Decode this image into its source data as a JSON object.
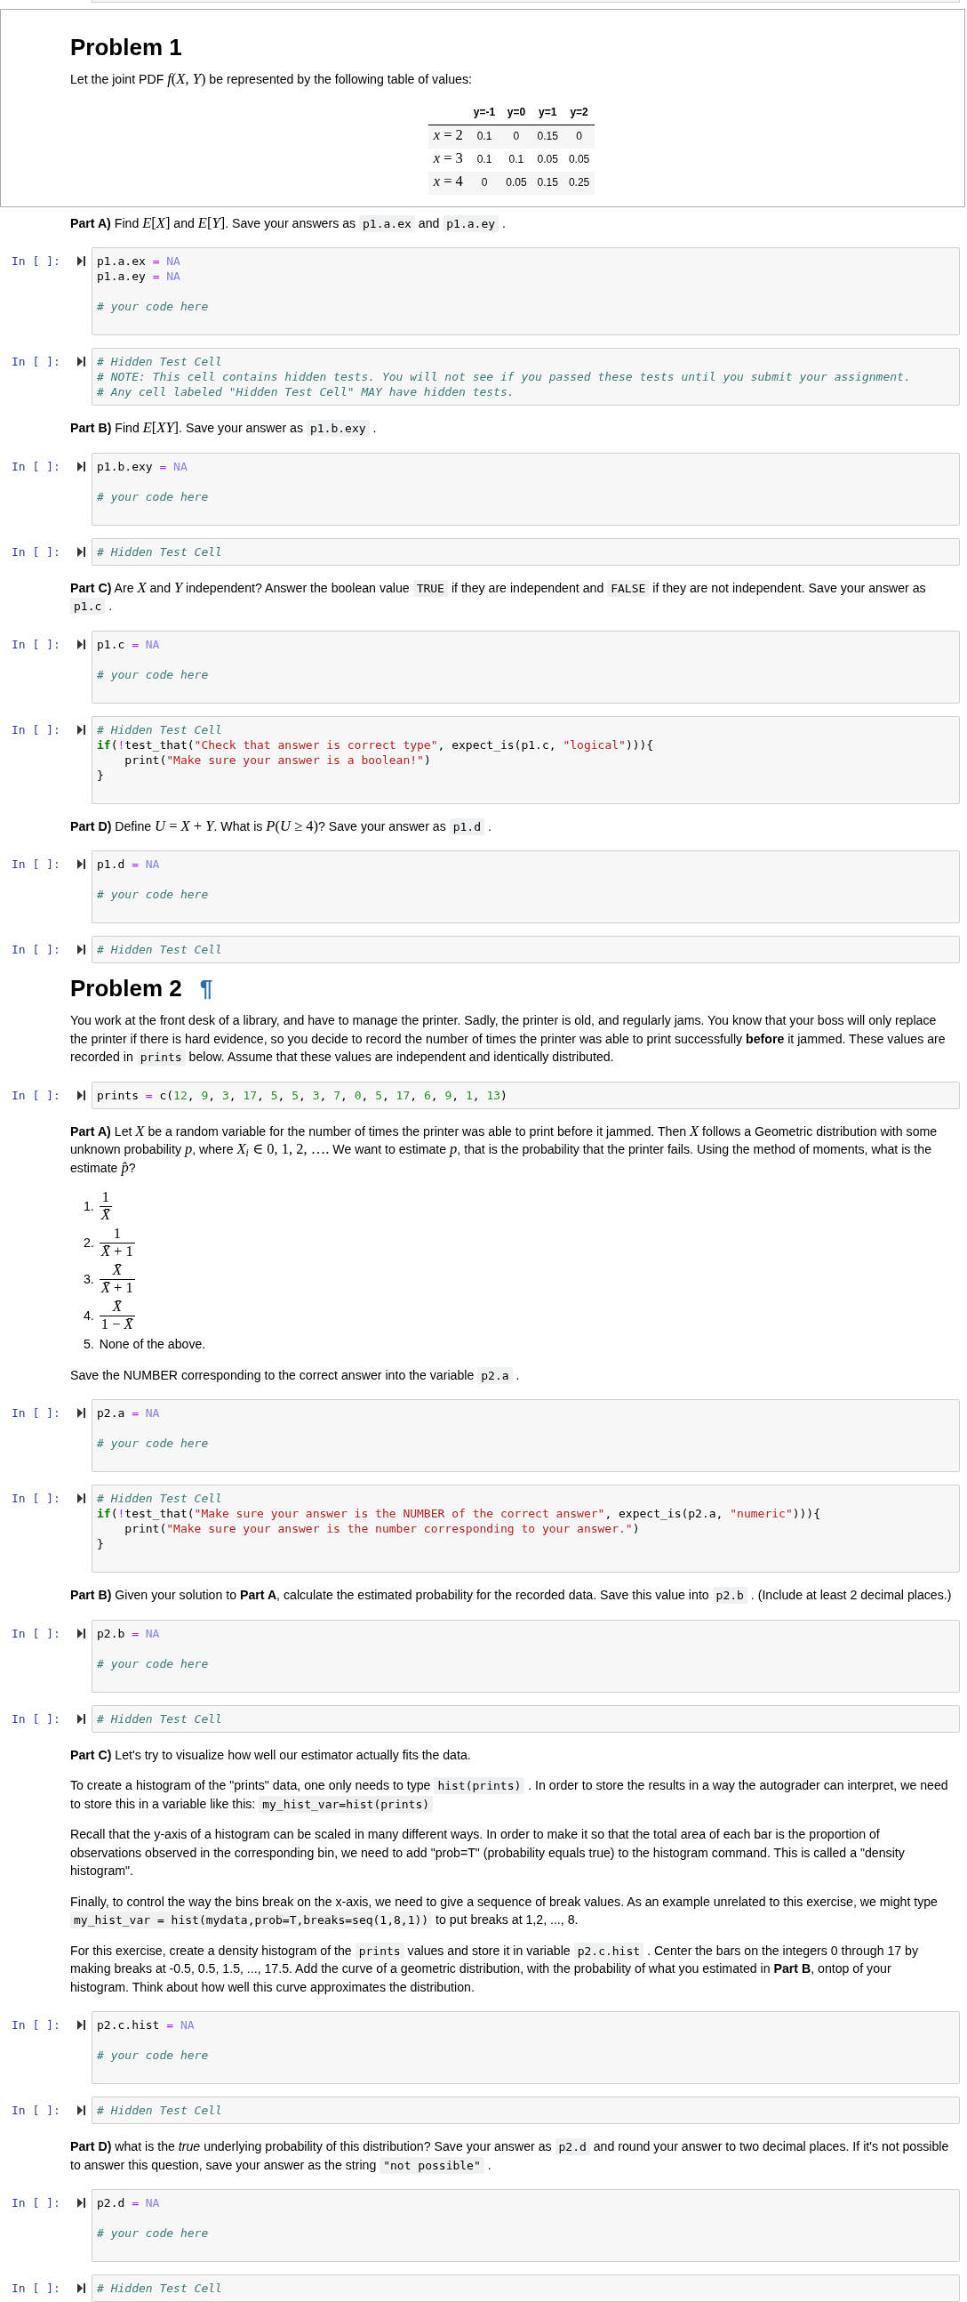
{
  "cells": [
    {
      "kind": "markdown",
      "selected": true,
      "blocks": [
        {
          "kind": "heading",
          "text": "Problem 1"
        },
        {
          "kind": "paragraph",
          "runs": [
            {
              "kind": "text",
              "text": "Let the joint PDF "
            },
            {
              "kind": "math",
              "text": "*f*(*X*, *Y*)"
            },
            {
              "kind": "text",
              "text": " be represented by the following table of values:"
            }
          ]
        },
        {
          "kind": "table",
          "columns": [
            "y=-1",
            "y=0",
            "y=1",
            "y=2"
          ],
          "rows": [
            {
              "label": "*x* = 2",
              "cells": [
                "0.1",
                "0",
                "0.15",
                "0"
              ]
            },
            {
              "label": "*x* = 3",
              "cells": [
                "0.1",
                "0.1",
                "0.05",
                "0.05"
              ]
            },
            {
              "label": "*x* = 4",
              "cells": [
                "0",
                "0.05",
                "0.15",
                "0.25"
              ]
            }
          ]
        }
      ]
    },
    {
      "kind": "markdown",
      "selected": false,
      "blocks": [
        {
          "kind": "paragraph",
          "runs": [
            {
              "kind": "text",
              "text": "**Part A)** Find "
            },
            {
              "kind": "math",
              "text": "*E*[*X*]"
            },
            {
              "kind": "text",
              "text": " and "
            },
            {
              "kind": "math",
              "text": "*E*[*Y*]"
            },
            {
              "kind": "text",
              "text": ". Save your answers as "
            },
            {
              "kind": "code",
              "text": "p1.a.ex"
            },
            {
              "kind": "text",
              "text": " and "
            },
            {
              "kind": "code",
              "text": "p1.a.ey"
            },
            {
              "kind": "text",
              "text": " ."
            }
          ]
        }
      ]
    },
    {
      "kind": "code",
      "selected": false,
      "prompt": "In [ ]:",
      "lines": [
        {
          "kind": "code",
          "tokens": [
            {
              "kind": "plain",
              "text": "p1.a.ex "
            },
            {
              "kind": "operator",
              "text": "="
            },
            {
              "kind": "constant",
              "text": " NA"
            }
          ]
        },
        {
          "kind": "code",
          "tokens": [
            {
              "kind": "plain",
              "text": "p1.a.ey "
            },
            {
              "kind": "operator",
              "text": "="
            },
            {
              "kind": "constant",
              "text": " NA"
            }
          ]
        },
        {
          "kind": "blank"
        },
        {
          "kind": "code",
          "tokens": [
            {
              "kind": "comment",
              "text": "# your code here"
            }
          ]
        },
        {
          "kind": "blank"
        }
      ]
    },
    {
      "kind": "code",
      "selected": false,
      "prompt": "In [ ]:",
      "lines": [
        {
          "kind": "code",
          "tokens": [
            {
              "kind": "comment",
              "text": "# Hidden Test Cell"
            }
          ]
        },
        {
          "kind": "code",
          "tokens": [
            {
              "kind": "comment",
              "text": "# NOTE: This cell contains hidden tests. You will not see if you passed these tests until you submit your assignment."
            }
          ]
        },
        {
          "kind": "code",
          "tokens": [
            {
              "kind": "comment",
              "text": "# Any cell labeled \"Hidden Test Cell\" MAY have hidden tests."
            }
          ]
        }
      ]
    },
    {
      "kind": "markdown",
      "selected": false,
      "blocks": [
        {
          "kind": "paragraph",
          "runs": [
            {
              "kind": "text",
              "text": "**Part B)** Find "
            },
            {
              "kind": "math",
              "text": "*E*[*XY*]"
            },
            {
              "kind": "text",
              "text": ". Save your answer as "
            },
            {
              "kind": "code",
              "text": "p1.b.exy"
            },
            {
              "kind": "text",
              "text": " ."
            }
          ]
        }
      ]
    },
    {
      "kind": "code",
      "selected": false,
      "prompt": "In [ ]:",
      "lines": [
        {
          "kind": "code",
          "tokens": [
            {
              "kind": "plain",
              "text": "p1.b.exy "
            },
            {
              "kind": "operator",
              "text": "="
            },
            {
              "kind": "constant",
              "text": " NA"
            }
          ]
        },
        {
          "kind": "blank"
        },
        {
          "kind": "code",
          "tokens": [
            {
              "kind": "comment",
              "text": "# your code here"
            }
          ]
        },
        {
          "kind": "blank"
        }
      ]
    },
    {
      "kind": "code",
      "selected": false,
      "prompt": "In [ ]:",
      "lines": [
        {
          "kind": "code",
          "tokens": [
            {
              "kind": "comment",
              "text": "# Hidden Test Cell"
            }
          ]
        }
      ]
    },
    {
      "kind": "markdown",
      "selected": false,
      "blocks": [
        {
          "kind": "paragraph",
          "runs": [
            {
              "kind": "text",
              "text": "**Part C)** Are "
            },
            {
              "kind": "variable",
              "text": "X"
            },
            {
              "kind": "text",
              "text": " and "
            },
            {
              "kind": "variable",
              "text": "Y"
            },
            {
              "kind": "text",
              "text": " independent? Answer the boolean value "
            },
            {
              "kind": "code",
              "text": "TRUE"
            },
            {
              "kind": "text",
              "text": " if they are independent and "
            },
            {
              "kind": "code",
              "text": "FALSE"
            },
            {
              "kind": "text",
              "text": " if they are not independent. Save your answer as "
            },
            {
              "kind": "code",
              "text": "p1.c"
            },
            {
              "kind": "text",
              "text": " ."
            }
          ]
        }
      ]
    },
    {
      "kind": "code",
      "selected": false,
      "prompt": "In [ ]:",
      "lines": [
        {
          "kind": "code",
          "tokens": [
            {
              "kind": "plain",
              "text": "p1.c "
            },
            {
              "kind": "operator",
              "text": "="
            },
            {
              "kind": "constant",
              "text": " NA"
            }
          ]
        },
        {
          "kind": "blank"
        },
        {
          "kind": "code",
          "tokens": [
            {
              "kind": "comment",
              "text": "# your code here"
            }
          ]
        },
        {
          "kind": "blank"
        }
      ]
    },
    {
      "kind": "code",
      "selected": false,
      "prompt": "In [ ]:",
      "lines": [
        {
          "kind": "code",
          "tokens": [
            {
              "kind": "comment",
              "text": "# Hidden Test Cell"
            }
          ]
        },
        {
          "kind": "code",
          "tokens": [
            {
              "kind": "keyword",
              "text": "if"
            },
            {
              "kind": "plain",
              "text": "("
            },
            {
              "kind": "operator",
              "text": "!"
            },
            {
              "kind": "plain",
              "text": "test_that("
            },
            {
              "kind": "string",
              "text": "\"Check that answer is correct type\""
            },
            {
              "kind": "plain",
              "text": ", expect_is(p1.c, "
            },
            {
              "kind": "string",
              "text": "\"logical\""
            },
            {
              "kind": "plain",
              "text": "))){"
            }
          ]
        },
        {
          "kind": "code",
          "tokens": [
            {
              "kind": "plain",
              "text": "    print("
            },
            {
              "kind": "string",
              "text": "\"Make sure your answer is a boolean!\""
            },
            {
              "kind": "plain",
              "text": ")"
            }
          ]
        },
        {
          "kind": "code",
          "tokens": [
            {
              "kind": "plain",
              "text": "}"
            }
          ]
        },
        {
          "kind": "blank"
        }
      ]
    },
    {
      "kind": "markdown",
      "selected": false,
      "blocks": [
        {
          "kind": "paragraph",
          "runs": [
            {
              "kind": "text",
              "text": "**Part D)** Define "
            },
            {
              "kind": "math",
              "text": "*U* = *X* + *Y*"
            },
            {
              "kind": "text",
              "text": ". What is "
            },
            {
              "kind": "math",
              "text": "*P*(*U* ≥ 4)"
            },
            {
              "kind": "text",
              "text": "? Save your answer as "
            },
            {
              "kind": "code",
              "text": "p1.d"
            },
            {
              "kind": "text",
              "text": " ."
            }
          ]
        }
      ]
    },
    {
      "kind": "code",
      "selected": false,
      "prompt": "In [ ]:",
      "lines": [
        {
          "kind": "code",
          "tokens": [
            {
              "kind": "plain",
              "text": "p1.d "
            },
            {
              "kind": "operator",
              "text": "="
            },
            {
              "kind": "constant",
              "text": " NA"
            }
          ]
        },
        {
          "kind": "blank"
        },
        {
          "kind": "code",
          "tokens": [
            {
              "kind": "comment",
              "text": "# your code here"
            }
          ]
        },
        {
          "kind": "blank"
        }
      ]
    },
    {
      "kind": "code",
      "selected": false,
      "prompt": "In [ ]:",
      "lines": [
        {
          "kind": "code",
          "tokens": [
            {
              "kind": "comment",
              "text": "# Hidden Test Cell"
            }
          ]
        }
      ]
    },
    {
      "kind": "markdown",
      "selected": false,
      "blocks": [
        {
          "kind": "heading",
          "text": "Problem 2",
          "anchor": "¶"
        },
        {
          "kind": "paragraph",
          "runs": [
            {
              "kind": "text",
              "text": "You work at the front desk of a library, and have to manage the printer. Sadly, the printer is old, and regularly jams. You know that your boss will only replace the printer if there is hard evidence, so you decide to record the number of times the printer was able to print successfully **before** it jammed. These values are recorded in "
            },
            {
              "kind": "code",
              "text": "prints"
            },
            {
              "kind": "text",
              "text": " below. Assume that these values are independent and identically distributed."
            }
          ]
        }
      ]
    },
    {
      "kind": "code",
      "selected": false,
      "prompt": "In [ ]:",
      "lines": [
        {
          "kind": "code",
          "tokens": [
            {
              "kind": "plain",
              "text": "prints "
            },
            {
              "kind": "operator",
              "text": "="
            },
            {
              "kind": "plain",
              "text": " c("
            },
            {
              "kind": "number",
              "text": "12"
            },
            {
              "kind": "plain",
              "text": ", "
            },
            {
              "kind": "number",
              "text": "9"
            },
            {
              "kind": "plain",
              "text": ", "
            },
            {
              "kind": "number",
              "text": "3"
            },
            {
              "kind": "plain",
              "text": ", "
            },
            {
              "kind": "number",
              "text": "17"
            },
            {
              "kind": "plain",
              "text": ", "
            },
            {
              "kind": "number",
              "text": "5"
            },
            {
              "kind": "plain",
              "text": ", "
            },
            {
              "kind": "number",
              "text": "5"
            },
            {
              "kind": "plain",
              "text": ", "
            },
            {
              "kind": "number",
              "text": "3"
            },
            {
              "kind": "plain",
              "text": ", "
            },
            {
              "kind": "number",
              "text": "7"
            },
            {
              "kind": "plain",
              "text": ", "
            },
            {
              "kind": "number",
              "text": "0"
            },
            {
              "kind": "plain",
              "text": ", "
            },
            {
              "kind": "number",
              "text": "5"
            },
            {
              "kind": "plain",
              "text": ", "
            },
            {
              "kind": "number",
              "text": "17"
            },
            {
              "kind": "plain",
              "text": ", "
            },
            {
              "kind": "number",
              "text": "6"
            },
            {
              "kind": "plain",
              "text": ", "
            },
            {
              "kind": "number",
              "text": "9"
            },
            {
              "kind": "plain",
              "text": ", "
            },
            {
              "kind": "number",
              "text": "1"
            },
            {
              "kind": "plain",
              "text": ", "
            },
            {
              "kind": "number",
              "text": "13"
            },
            {
              "kind": "plain",
              "text": ")"
            }
          ]
        }
      ]
    },
    {
      "kind": "markdown",
      "selected": false,
      "blocks": [
        {
          "kind": "paragraph",
          "runs": [
            {
              "kind": "text",
              "text": "**Part A)** Let "
            },
            {
              "kind": "variable",
              "text": "X"
            },
            {
              "kind": "text",
              "text": " be a random variable for the number of times the printer was able to print before it jammed. Then "
            },
            {
              "kind": "variable",
              "text": "X"
            },
            {
              "kind": "text",
              "text": " follows a Geometric distribution with some unknown probability "
            },
            {
              "kind": "variable",
              "text": "p"
            },
            {
              "kind": "text",
              "text": ", where "
            },
            {
              "kind": "math",
              "text": "*X*$_{i}$ ∈ 0, 1, 2, …."
            },
            {
              "kind": "text",
              "text": " We want to estimate "
            },
            {
              "kind": "variable",
              "text": "p"
            },
            {
              "kind": "text",
              "text": ", that is the probability that the printer fails. Using the method of moments, what is the estimate "
            },
            {
              "kind": "variable",
              "text": "p̂"
            },
            {
              "kind": "text",
              "text": "?"
            }
          ]
        },
        {
          "kind": "list",
          "items": [
            {
              "number": "1.",
              "kind": "fraction",
              "numerator": {
                "kind": "math",
                "text": "1"
              },
              "denominator": {
                "kind": "variable",
                "text": "X̄"
              }
            },
            {
              "number": "2.",
              "kind": "fraction",
              "numerator": {
                "kind": "math",
                "text": "1"
              },
              "denominator": {
                "kind": "math",
                "text": "*X̄* + 1"
              }
            },
            {
              "number": "3.",
              "kind": "fraction",
              "numerator": {
                "kind": "variable",
                "text": "X̄"
              },
              "denominator": {
                "kind": "math",
                "text": "*X̄* + 1"
              }
            },
            {
              "number": "4.",
              "kind": "fraction",
              "numerator": {
                "kind": "variable",
                "text": "X̄"
              },
              "denominator": {
                "kind": "math",
                "text": "1 − *X̄*"
              }
            },
            {
              "number": "5.",
              "kind": "text",
              "text": "None of the above."
            }
          ]
        },
        {
          "kind": "paragraph",
          "runs": [
            {
              "kind": "text",
              "text": "Save the NUMBER corresponding to the correct answer into the variable "
            },
            {
              "kind": "code",
              "text": "p2.a"
            },
            {
              "kind": "text",
              "text": " ."
            }
          ]
        }
      ]
    },
    {
      "kind": "code",
      "selected": false,
      "prompt": "In [ ]:",
      "lines": [
        {
          "kind": "code",
          "tokens": [
            {
              "kind": "plain",
              "text": "p2.a "
            },
            {
              "kind": "operator",
              "text": "="
            },
            {
              "kind": "constant",
              "text": " NA"
            }
          ]
        },
        {
          "kind": "blank"
        },
        {
          "kind": "code",
          "tokens": [
            {
              "kind": "comment",
              "text": "# your code here"
            }
          ]
        },
        {
          "kind": "blank"
        }
      ]
    },
    {
      "kind": "code",
      "selected": false,
      "prompt": "In [ ]:",
      "lines": [
        {
          "kind": "code",
          "tokens": [
            {
              "kind": "comment",
              "text": "# Hidden Test Cell"
            }
          ]
        },
        {
          "kind": "code",
          "tokens": [
            {
              "kind": "keyword",
              "text": "if"
            },
            {
              "kind": "plain",
              "text": "("
            },
            {
              "kind": "operator",
              "text": "!"
            },
            {
              "kind": "plain",
              "text": "test_that("
            },
            {
              "kind": "string",
              "text": "\"Make sure your answer is the NUMBER of the correct answer\""
            },
            {
              "kind": "plain",
              "text": ", expect_is(p2.a, "
            },
            {
              "kind": "string",
              "text": "\"numeric\""
            },
            {
              "kind": "plain",
              "text": "))){"
            }
          ]
        },
        {
          "kind": "code",
          "tokens": [
            {
              "kind": "plain",
              "text": "    print("
            },
            {
              "kind": "string",
              "text": "\"Make sure your answer is the number corresponding to your answer.\""
            },
            {
              "kind": "plain",
              "text": ")"
            }
          ]
        },
        {
          "kind": "code",
          "tokens": [
            {
              "kind": "plain",
              "text": "}"
            }
          ]
        },
        {
          "kind": "blank"
        }
      ]
    },
    {
      "kind": "markdown",
      "selected": false,
      "blocks": [
        {
          "kind": "paragraph",
          "runs": [
            {
              "kind": "text",
              "text": "**Part B)** Given your solution to **Part A**, calculate the estimated probability for the recorded data. Save this value into "
            },
            {
              "kind": "code",
              "text": "p2.b"
            },
            {
              "kind": "text",
              "text": " . (Include at least 2 decimal places.)"
            }
          ]
        }
      ]
    },
    {
      "kind": "code",
      "selected": false,
      "prompt": "In [ ]:",
      "lines": [
        {
          "kind": "code",
          "tokens": [
            {
              "kind": "plain",
              "text": "p2.b "
            },
            {
              "kind": "operator",
              "text": "="
            },
            {
              "kind": "constant",
              "text": " NA"
            }
          ]
        },
        {
          "kind": "blank"
        },
        {
          "kind": "code",
          "tokens": [
            {
              "kind": "comment",
              "text": "# your code here"
            }
          ]
        },
        {
          "kind": "blank"
        }
      ]
    },
    {
      "kind": "code",
      "selected": false,
      "prompt": "In [ ]:",
      "lines": [
        {
          "kind": "code",
          "tokens": [
            {
              "kind": "comment",
              "text": "# Hidden Test Cell"
            }
          ]
        }
      ]
    },
    {
      "kind": "markdown",
      "selected": false,
      "blocks": [
        {
          "kind": "paragraph",
          "runs": [
            {
              "kind": "text",
              "text": "**Part C)** Let's try to visualize how well our estimator actually fits the data."
            }
          ]
        },
        {
          "kind": "paragraph",
          "runs": [
            {
              "kind": "text",
              "text": "To create a histogram of the \"prints\" data, one only needs to type "
            },
            {
              "kind": "code",
              "text": "hist(prints)"
            },
            {
              "kind": "text",
              "text": " . In order to store the results in a way the autograder can interpret, we need to store this in a variable like this: "
            },
            {
              "kind": "code",
              "text": "my_hist_var=hist(prints)"
            }
          ]
        },
        {
          "kind": "paragraph",
          "runs": [
            {
              "kind": "text",
              "text": "Recall that the y-axis of a histogram can be scaled in many different ways. In order to make it so that the total area of each bar is the proportion of observations observed in the corresponding bin, we need to add \"prob=T\" (probability equals true) to the histogram command. This is called a \"density histogram\"."
            }
          ]
        },
        {
          "kind": "paragraph",
          "runs": [
            {
              "kind": "text",
              "text": "Finally, to control the way the bins break on the x-axis, we need to give a sequence of break values. As an example unrelated to this exercise, we might type "
            },
            {
              "kind": "code",
              "text": "my_hist_var = hist(mydata,prob=T,breaks=seq(1,8,1))"
            },
            {
              "kind": "text",
              "text": " to put breaks at 1,2, ..., 8."
            }
          ]
        },
        {
          "kind": "paragraph",
          "runs": [
            {
              "kind": "text",
              "text": "For this exercise, create a density histogram of the "
            },
            {
              "kind": "code",
              "text": "prints"
            },
            {
              "kind": "text",
              "text": " values and store it in variable "
            },
            {
              "kind": "code",
              "text": "p2.c.hist"
            },
            {
              "kind": "text",
              "text": " . Center the bars on the integers 0 through 17 by making breaks at -0.5, 0.5, 1.5, ..., 17.5. Add the curve of a geometric distribution, with the probability of what you estimated in **Part B**, ontop of your histogram. Think about how well this curve approximates the distribution."
            }
          ]
        }
      ]
    },
    {
      "kind": "code",
      "selected": false,
      "prompt": "In [ ]:",
      "lines": [
        {
          "kind": "code",
          "tokens": [
            {
              "kind": "plain",
              "text": "p2.c.hist "
            },
            {
              "kind": "operator",
              "text": "="
            },
            {
              "kind": "constant",
              "text": " NA"
            }
          ]
        },
        {
          "kind": "blank"
        },
        {
          "kind": "code",
          "tokens": [
            {
              "kind": "comment",
              "text": "# your code here"
            }
          ]
        },
        {
          "kind": "blank"
        }
      ]
    },
    {
      "kind": "code",
      "selected": false,
      "prompt": "In [ ]:",
      "lines": [
        {
          "kind": "code",
          "tokens": [
            {
              "kind": "comment",
              "text": "# Hidden Test Cell"
            }
          ]
        }
      ]
    },
    {
      "kind": "markdown",
      "selected": false,
      "blocks": [
        {
          "kind": "paragraph",
          "runs": [
            {
              "kind": "text",
              "text": "**Part D)** what is the *true* underlying probability of this distribution? Save your answer as "
            },
            {
              "kind": "code",
              "text": "p2.d"
            },
            {
              "kind": "text",
              "text": " and round your answer to two decimal places. If it's not possible to answer this question, save your answer as the string "
            },
            {
              "kind": "code",
              "text": "\"not possible\""
            },
            {
              "kind": "text",
              "text": " ."
            }
          ]
        }
      ]
    },
    {
      "kind": "code",
      "selected": false,
      "prompt": "In [ ]:",
      "lines": [
        {
          "kind": "code",
          "tokens": [
            {
              "kind": "plain",
              "text": "p2.d "
            },
            {
              "kind": "operator",
              "text": "="
            },
            {
              "kind": "constant",
              "text": " NA"
            }
          ]
        },
        {
          "kind": "blank"
        },
        {
          "kind": "code",
          "tokens": [
            {
              "kind": "comment",
              "text": "# your code here"
            }
          ]
        },
        {
          "kind": "blank"
        }
      ]
    },
    {
      "kind": "code",
      "selected": false,
      "prompt": "In [ ]:",
      "lines": [
        {
          "kind": "code",
          "tokens": [
            {
              "kind": "comment",
              "text": "# Hidden Test Cell"
            }
          ]
        }
      ]
    }
  ]
}
